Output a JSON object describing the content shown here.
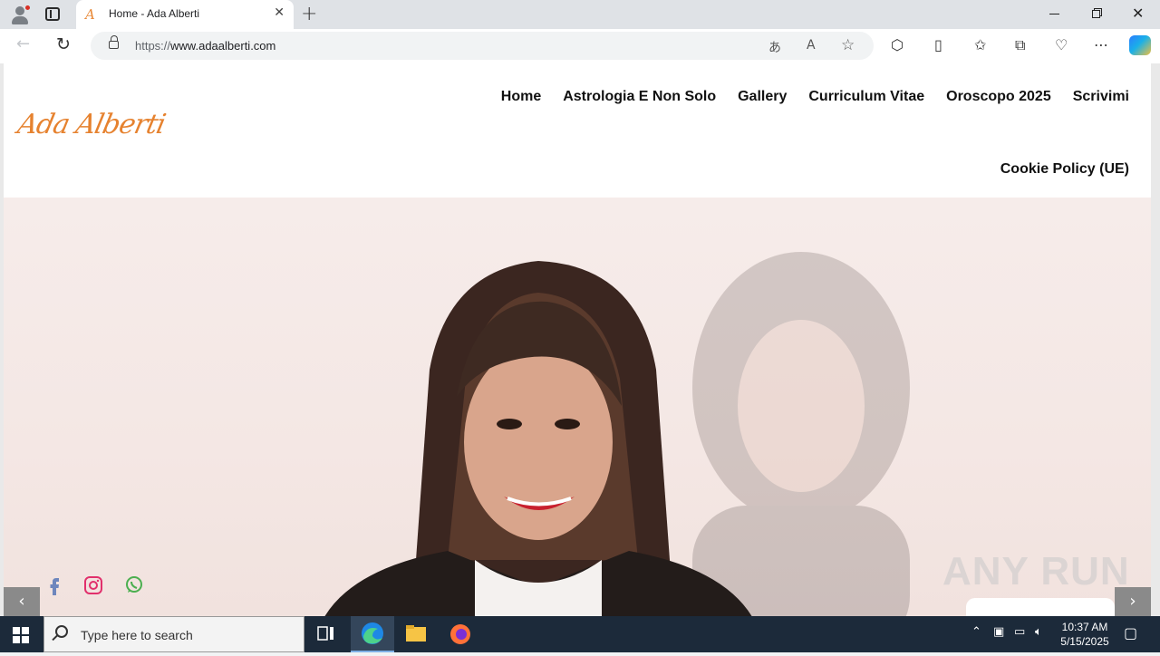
{
  "browser": {
    "tab_title": "Home - Ada Alberti",
    "tab_favicon": "A",
    "url_protocol": "https://",
    "url_host": "www.adaalberti.com",
    "icons": [
      "profile-icon",
      "tab-actions-icon",
      "close-tab-icon",
      "new-tab-icon",
      "back-icon",
      "reload-icon",
      "lock-icon",
      "translate-icon",
      "read-aloud-icon",
      "favorite-star-icon",
      "extensions-icon",
      "split-screen-icon",
      "favorites-icon",
      "collections-icon",
      "browser-essentials-icon",
      "more-icon",
      "copilot-icon"
    ]
  },
  "site": {
    "logo_text": "Ada Alberti",
    "nav": {
      "home": "Home",
      "astrologia": "Astrologia E Non Solo",
      "gallery": "Gallery",
      "cv": "Curriculum Vitae",
      "oroscopo": "Oroscopo 2025",
      "scrivimi": "Scrivimi",
      "cookie": "Cookie Policy (UE)"
    },
    "social_icons": [
      "facebook-icon",
      "instagram-icon",
      "whatsapp-icon"
    ],
    "slider_prev": "‹",
    "slider_next": "›",
    "watermark": "ANY RUN",
    "brand_color": "#e6822f"
  },
  "taskbar": {
    "search_placeholder": "Type here to search",
    "time": "10:37 AM",
    "date": "5/15/2025"
  }
}
